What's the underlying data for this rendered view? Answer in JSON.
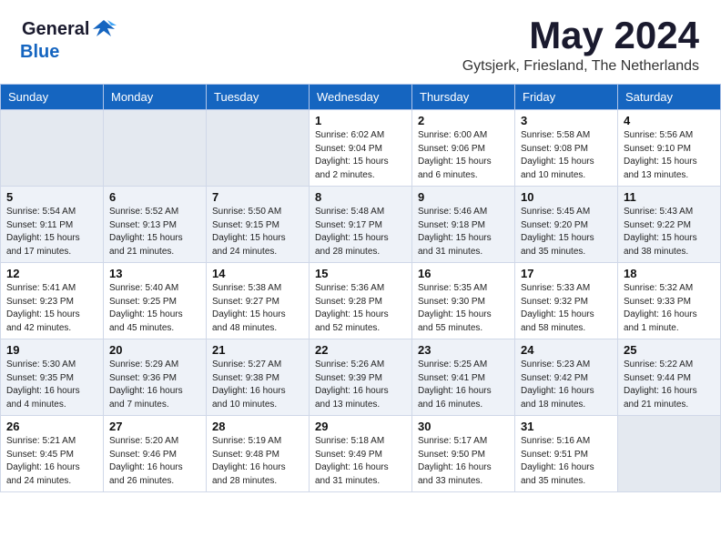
{
  "header": {
    "logo_general": "General",
    "logo_blue": "Blue",
    "month_title": "May 2024",
    "location": "Gytsjerk, Friesland, The Netherlands"
  },
  "days_of_week": [
    "Sunday",
    "Monday",
    "Tuesday",
    "Wednesday",
    "Thursday",
    "Friday",
    "Saturday"
  ],
  "weeks": [
    [
      {
        "day": "",
        "info": ""
      },
      {
        "day": "",
        "info": ""
      },
      {
        "day": "",
        "info": ""
      },
      {
        "day": "1",
        "info": "Sunrise: 6:02 AM\nSunset: 9:04 PM\nDaylight: 15 hours\nand 2 minutes."
      },
      {
        "day": "2",
        "info": "Sunrise: 6:00 AM\nSunset: 9:06 PM\nDaylight: 15 hours\nand 6 minutes."
      },
      {
        "day": "3",
        "info": "Sunrise: 5:58 AM\nSunset: 9:08 PM\nDaylight: 15 hours\nand 10 minutes."
      },
      {
        "day": "4",
        "info": "Sunrise: 5:56 AM\nSunset: 9:10 PM\nDaylight: 15 hours\nand 13 minutes."
      }
    ],
    [
      {
        "day": "5",
        "info": "Sunrise: 5:54 AM\nSunset: 9:11 PM\nDaylight: 15 hours\nand 17 minutes."
      },
      {
        "day": "6",
        "info": "Sunrise: 5:52 AM\nSunset: 9:13 PM\nDaylight: 15 hours\nand 21 minutes."
      },
      {
        "day": "7",
        "info": "Sunrise: 5:50 AM\nSunset: 9:15 PM\nDaylight: 15 hours\nand 24 minutes."
      },
      {
        "day": "8",
        "info": "Sunrise: 5:48 AM\nSunset: 9:17 PM\nDaylight: 15 hours\nand 28 minutes."
      },
      {
        "day": "9",
        "info": "Sunrise: 5:46 AM\nSunset: 9:18 PM\nDaylight: 15 hours\nand 31 minutes."
      },
      {
        "day": "10",
        "info": "Sunrise: 5:45 AM\nSunset: 9:20 PM\nDaylight: 15 hours\nand 35 minutes."
      },
      {
        "day": "11",
        "info": "Sunrise: 5:43 AM\nSunset: 9:22 PM\nDaylight: 15 hours\nand 38 minutes."
      }
    ],
    [
      {
        "day": "12",
        "info": "Sunrise: 5:41 AM\nSunset: 9:23 PM\nDaylight: 15 hours\nand 42 minutes."
      },
      {
        "day": "13",
        "info": "Sunrise: 5:40 AM\nSunset: 9:25 PM\nDaylight: 15 hours\nand 45 minutes."
      },
      {
        "day": "14",
        "info": "Sunrise: 5:38 AM\nSunset: 9:27 PM\nDaylight: 15 hours\nand 48 minutes."
      },
      {
        "day": "15",
        "info": "Sunrise: 5:36 AM\nSunset: 9:28 PM\nDaylight: 15 hours\nand 52 minutes."
      },
      {
        "day": "16",
        "info": "Sunrise: 5:35 AM\nSunset: 9:30 PM\nDaylight: 15 hours\nand 55 minutes."
      },
      {
        "day": "17",
        "info": "Sunrise: 5:33 AM\nSunset: 9:32 PM\nDaylight: 15 hours\nand 58 minutes."
      },
      {
        "day": "18",
        "info": "Sunrise: 5:32 AM\nSunset: 9:33 PM\nDaylight: 16 hours\nand 1 minute."
      }
    ],
    [
      {
        "day": "19",
        "info": "Sunrise: 5:30 AM\nSunset: 9:35 PM\nDaylight: 16 hours\nand 4 minutes."
      },
      {
        "day": "20",
        "info": "Sunrise: 5:29 AM\nSunset: 9:36 PM\nDaylight: 16 hours\nand 7 minutes."
      },
      {
        "day": "21",
        "info": "Sunrise: 5:27 AM\nSunset: 9:38 PM\nDaylight: 16 hours\nand 10 minutes."
      },
      {
        "day": "22",
        "info": "Sunrise: 5:26 AM\nSunset: 9:39 PM\nDaylight: 16 hours\nand 13 minutes."
      },
      {
        "day": "23",
        "info": "Sunrise: 5:25 AM\nSunset: 9:41 PM\nDaylight: 16 hours\nand 16 minutes."
      },
      {
        "day": "24",
        "info": "Sunrise: 5:23 AM\nSunset: 9:42 PM\nDaylight: 16 hours\nand 18 minutes."
      },
      {
        "day": "25",
        "info": "Sunrise: 5:22 AM\nSunset: 9:44 PM\nDaylight: 16 hours\nand 21 minutes."
      }
    ],
    [
      {
        "day": "26",
        "info": "Sunrise: 5:21 AM\nSunset: 9:45 PM\nDaylight: 16 hours\nand 24 minutes."
      },
      {
        "day": "27",
        "info": "Sunrise: 5:20 AM\nSunset: 9:46 PM\nDaylight: 16 hours\nand 26 minutes."
      },
      {
        "day": "28",
        "info": "Sunrise: 5:19 AM\nSunset: 9:48 PM\nDaylight: 16 hours\nand 28 minutes."
      },
      {
        "day": "29",
        "info": "Sunrise: 5:18 AM\nSunset: 9:49 PM\nDaylight: 16 hours\nand 31 minutes."
      },
      {
        "day": "30",
        "info": "Sunrise: 5:17 AM\nSunset: 9:50 PM\nDaylight: 16 hours\nand 33 minutes."
      },
      {
        "day": "31",
        "info": "Sunrise: 5:16 AM\nSunset: 9:51 PM\nDaylight: 16 hours\nand 35 minutes."
      },
      {
        "day": "",
        "info": ""
      }
    ]
  ]
}
